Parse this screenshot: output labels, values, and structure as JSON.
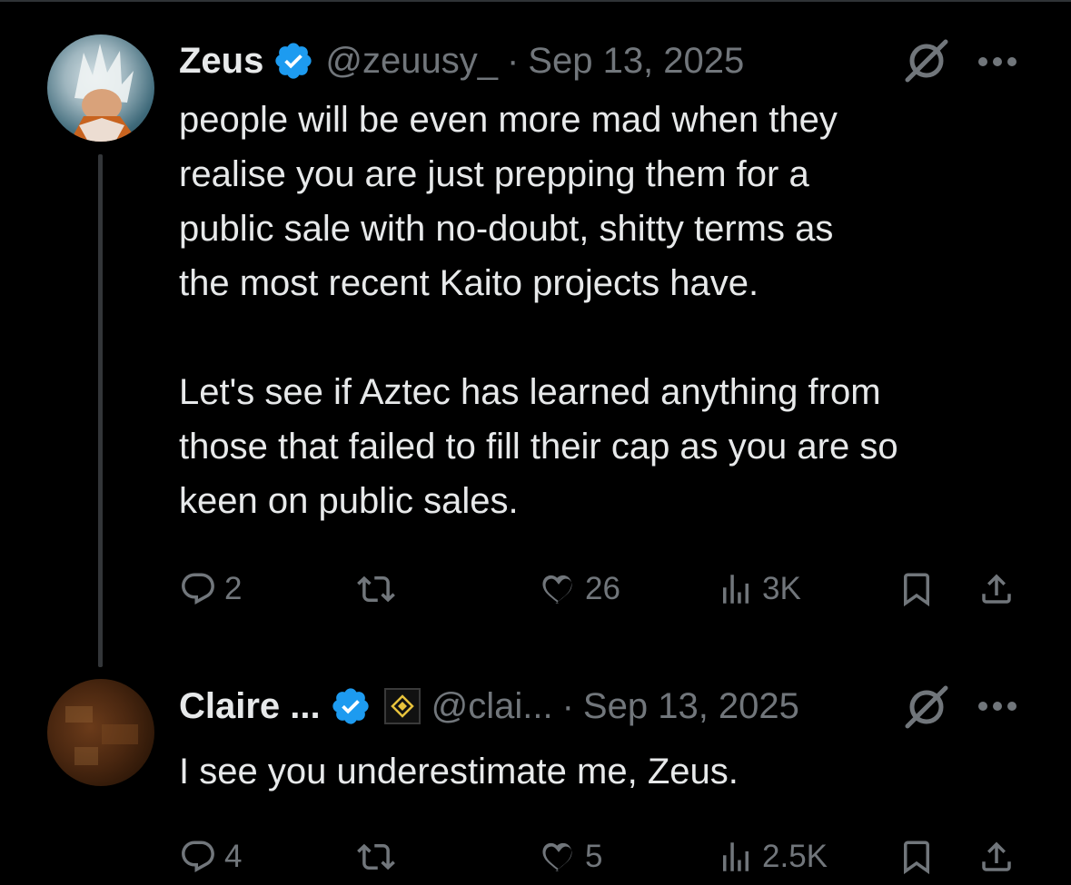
{
  "posts": [
    {
      "name": "Zeus",
      "handle": "@zeuusy_",
      "separator": "·",
      "date": "Sep 13, 2025",
      "text_1": "people will be even more mad when they\nrealise you are just prepping them for a\npublic sale with no-doubt, shitty terms as\nthe most recent Kaito projects have.",
      "text_2": "Let's see if Aztec has learned anything from\nthose that failed to fill their cap as you are so\nkeen on public sales.",
      "replies": "2",
      "reposts": "",
      "likes": "26",
      "views": "3K"
    },
    {
      "name": "Claire ...",
      "handle": "@clai...",
      "separator": "·",
      "date": "Sep 13, 2025",
      "text_1": "I see you underestimate me, Zeus.",
      "replies": "4",
      "reposts": "",
      "likes": "5",
      "views": "2.5K"
    }
  ],
  "colors": {
    "verified": "#1d9bf0",
    "muted": "#71767b",
    "text": "#e7e9ea",
    "background": "#000000",
    "badge_gold": "#e8c33c"
  },
  "icons": [
    "verified-badge-icon",
    "grok-icon",
    "more-icon",
    "reply-icon",
    "repost-icon",
    "like-icon",
    "views-icon",
    "bookmark-icon",
    "share-icon"
  ]
}
